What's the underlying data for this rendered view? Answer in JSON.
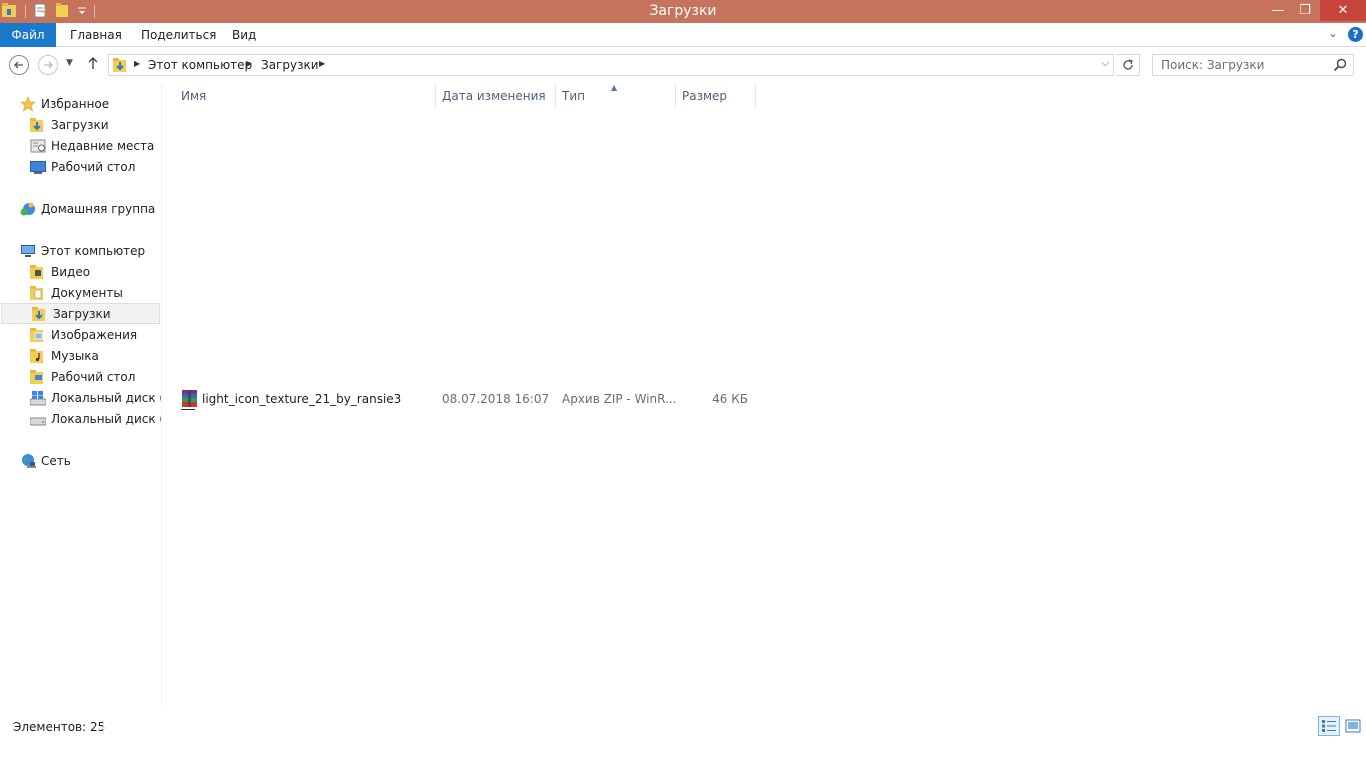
{
  "window": {
    "title": "Загрузки",
    "controls": {
      "minimize": "—",
      "maximize": "❐",
      "close": "✕"
    }
  },
  "ribbon": {
    "tabs": [
      "Файл",
      "Главная",
      "Поделиться",
      "Вид"
    ],
    "help": "?"
  },
  "navigation": {
    "breadcrumbs": [
      "Этот компьютер",
      "Загрузки"
    ],
    "search_placeholder": "Поиск: Загрузки"
  },
  "sidebar": {
    "favorites": {
      "label": "Избранное",
      "items": [
        "Загрузки",
        "Недавние места",
        "Рабочий стол"
      ]
    },
    "homegroup": {
      "label": "Домашняя группа"
    },
    "computer": {
      "label": "Этот компьютер",
      "items": [
        "Видео",
        "Документы",
        "Загрузки",
        "Изображения",
        "Музыка",
        "Рабочий стол",
        "Локальный диск (C:",
        "Локальный диск (E:)"
      ]
    },
    "network": {
      "label": "Сеть"
    }
  },
  "columns": {
    "name": "Имя",
    "date": "Дата изменения",
    "type": "Тип",
    "size": "Размер"
  },
  "files": [
    {
      "name": "light_icon_texture_21_by_ransie3",
      "date": "08.07.2018 16:07",
      "type": "Архив ZIP - WinR...",
      "size": "46 КБ",
      "icon": "winrar-archive-icon"
    }
  ],
  "status": {
    "count": "Элементов: 25"
  },
  "colors": {
    "titlebar": "#c5735a",
    "file_tab": "#1979ca",
    "close_button": "#c7443a",
    "column_header_text": "#4c607a"
  }
}
